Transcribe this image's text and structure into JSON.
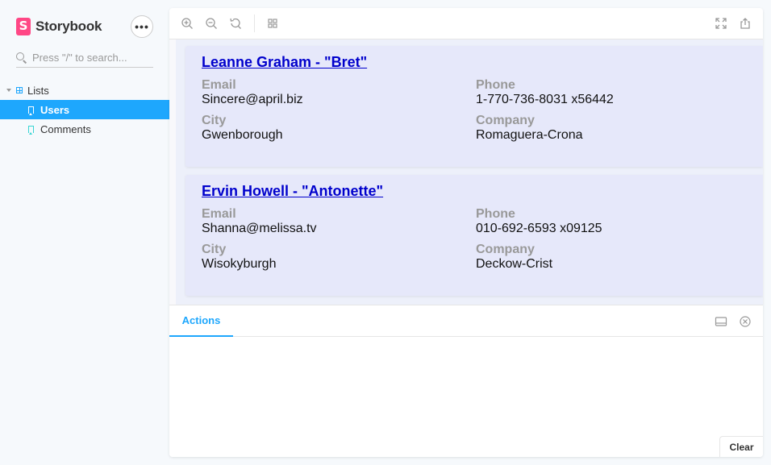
{
  "sidebar": {
    "brand": "Storybook",
    "brand_logo_letter": "S",
    "menu_label": "•••",
    "search_placeholder": "Press \"/\" to search...",
    "group_label": "Lists",
    "items": [
      {
        "label": "Users",
        "selected": true
      },
      {
        "label": "Comments",
        "selected": false
      }
    ]
  },
  "toolbar": {
    "icons": [
      "zoom-in-icon",
      "zoom-out-icon",
      "zoom-reset-icon",
      "grid-icon",
      "fullscreen-icon",
      "share-icon"
    ]
  },
  "cards": [
    {
      "title": "Leanne Graham - \"Bret\"",
      "email_label": "Email",
      "email": "Sincere@april.biz",
      "phone_label": "Phone",
      "phone": "1-770-736-8031 x56442",
      "city_label": "City",
      "city": "Gwenborough",
      "company_label": "Company",
      "company": "Romaguera-Crona"
    },
    {
      "title": "Ervin Howell - \"Antonette\"",
      "email_label": "Email",
      "email": "Shanna@melissa.tv",
      "phone_label": "Phone",
      "phone": "010-692-6593 x09125",
      "city_label": "City",
      "city": "Wisokyburgh",
      "company_label": "Company",
      "company": "Deckow-Crist"
    }
  ],
  "addons": {
    "tab_label": "Actions",
    "clear_label": "Clear"
  },
  "colors": {
    "accent": "#1ea7fd",
    "brand": "#ff4785",
    "card_bg": "#e6e8fa",
    "link": "#0000cc"
  }
}
